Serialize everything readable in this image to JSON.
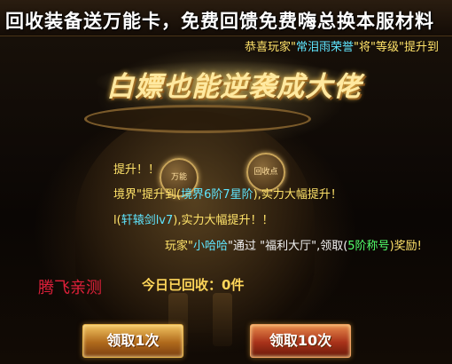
{
  "banner": {
    "text": "回收装备送万能卡，免费回馈免费嗨总换本服材料"
  },
  "notice_top": {
    "prefix": "恭喜玩家\"",
    "player": "常泪雨荣誉",
    "mid": "\"将\"等级\"提升到"
  },
  "title": "白嫖也能逆袭成大佬",
  "items": [
    {
      "label": "万能"
    },
    {
      "label": "回收点"
    }
  ],
  "messages": {
    "m1": "提升！！",
    "m2_a": "境界\"提升到(",
    "m2_b": "境界6阶7星阶",
    "m2_c": "),实力大幅提升！",
    "m3_a": "l(",
    "m3_b": "轩辕剑lv7",
    "m3_c": "),实力大幅提升！！",
    "m4_a": "玩家\"",
    "m4_b": "小哈哈",
    "m4_c": "\"通过 \"福利大厅\",领取(",
    "m4_d": "5阶称号",
    "m4_e": ")奖励!"
  },
  "watermark": "腾飞亲测",
  "today_recycled": "今日已回收：0件",
  "buttons": {
    "claim1": "领取1次",
    "claim10": "领取10次"
  }
}
